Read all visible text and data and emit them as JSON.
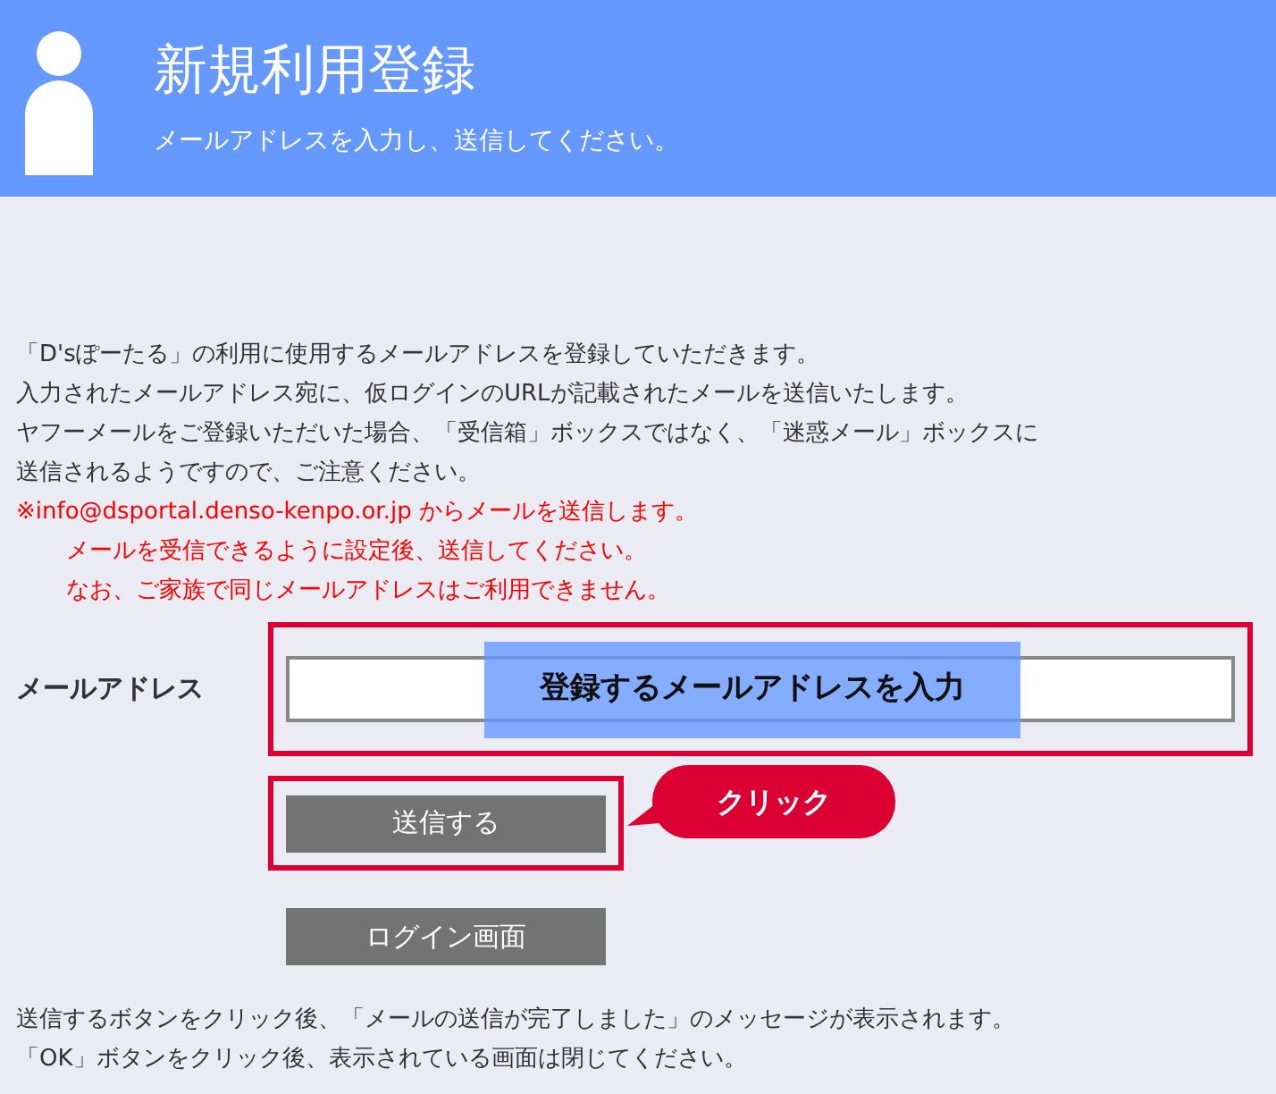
{
  "header": {
    "title": "新規利用登録",
    "subtitle": "メールアドレスを入力し、送信してください。"
  },
  "notes": [
    {
      "text": "「D'sぽーたる」の利用に使用するメールアドレスを登録していただきます。",
      "kind": "normal"
    },
    {
      "text": "入力されたメールアドレス宛に、仮ログインのURLが記載されたメールを送信いたします。",
      "kind": "normal"
    },
    {
      "text": "ヤフーメールをご登録いただいた場合、「受信箱」ボックスではなく、「迷惑メール」ボックスに",
      "kind": "normal"
    },
    {
      "text": "送信されるようですので、ご注意ください。",
      "kind": "normal"
    },
    {
      "text": "※info@dsportal.denso-kenpo.or.jp からメールを送信します。",
      "kind": "warning",
      "children": [
        {
          "text": "メールを受信できるように設定後、送信してください。",
          "kind": "warning"
        },
        {
          "text": "なお、ご家族で同じメールアドレスはご利用できません。",
          "kind": "warning"
        }
      ]
    }
  ],
  "form": {
    "label": "メールアドレス",
    "field_annotation": "登録するメールアドレスを入力",
    "submit_button": "送信する",
    "callout": "クリック",
    "login_button": "ログイン画面"
  },
  "footer": [
    "送信するボタンをクリック後、「メールの送信が完了しました」のメッセージが表示されます。",
    "「OK」ボタンをクリック後、表示されている画面は閉じてください。"
  ]
}
